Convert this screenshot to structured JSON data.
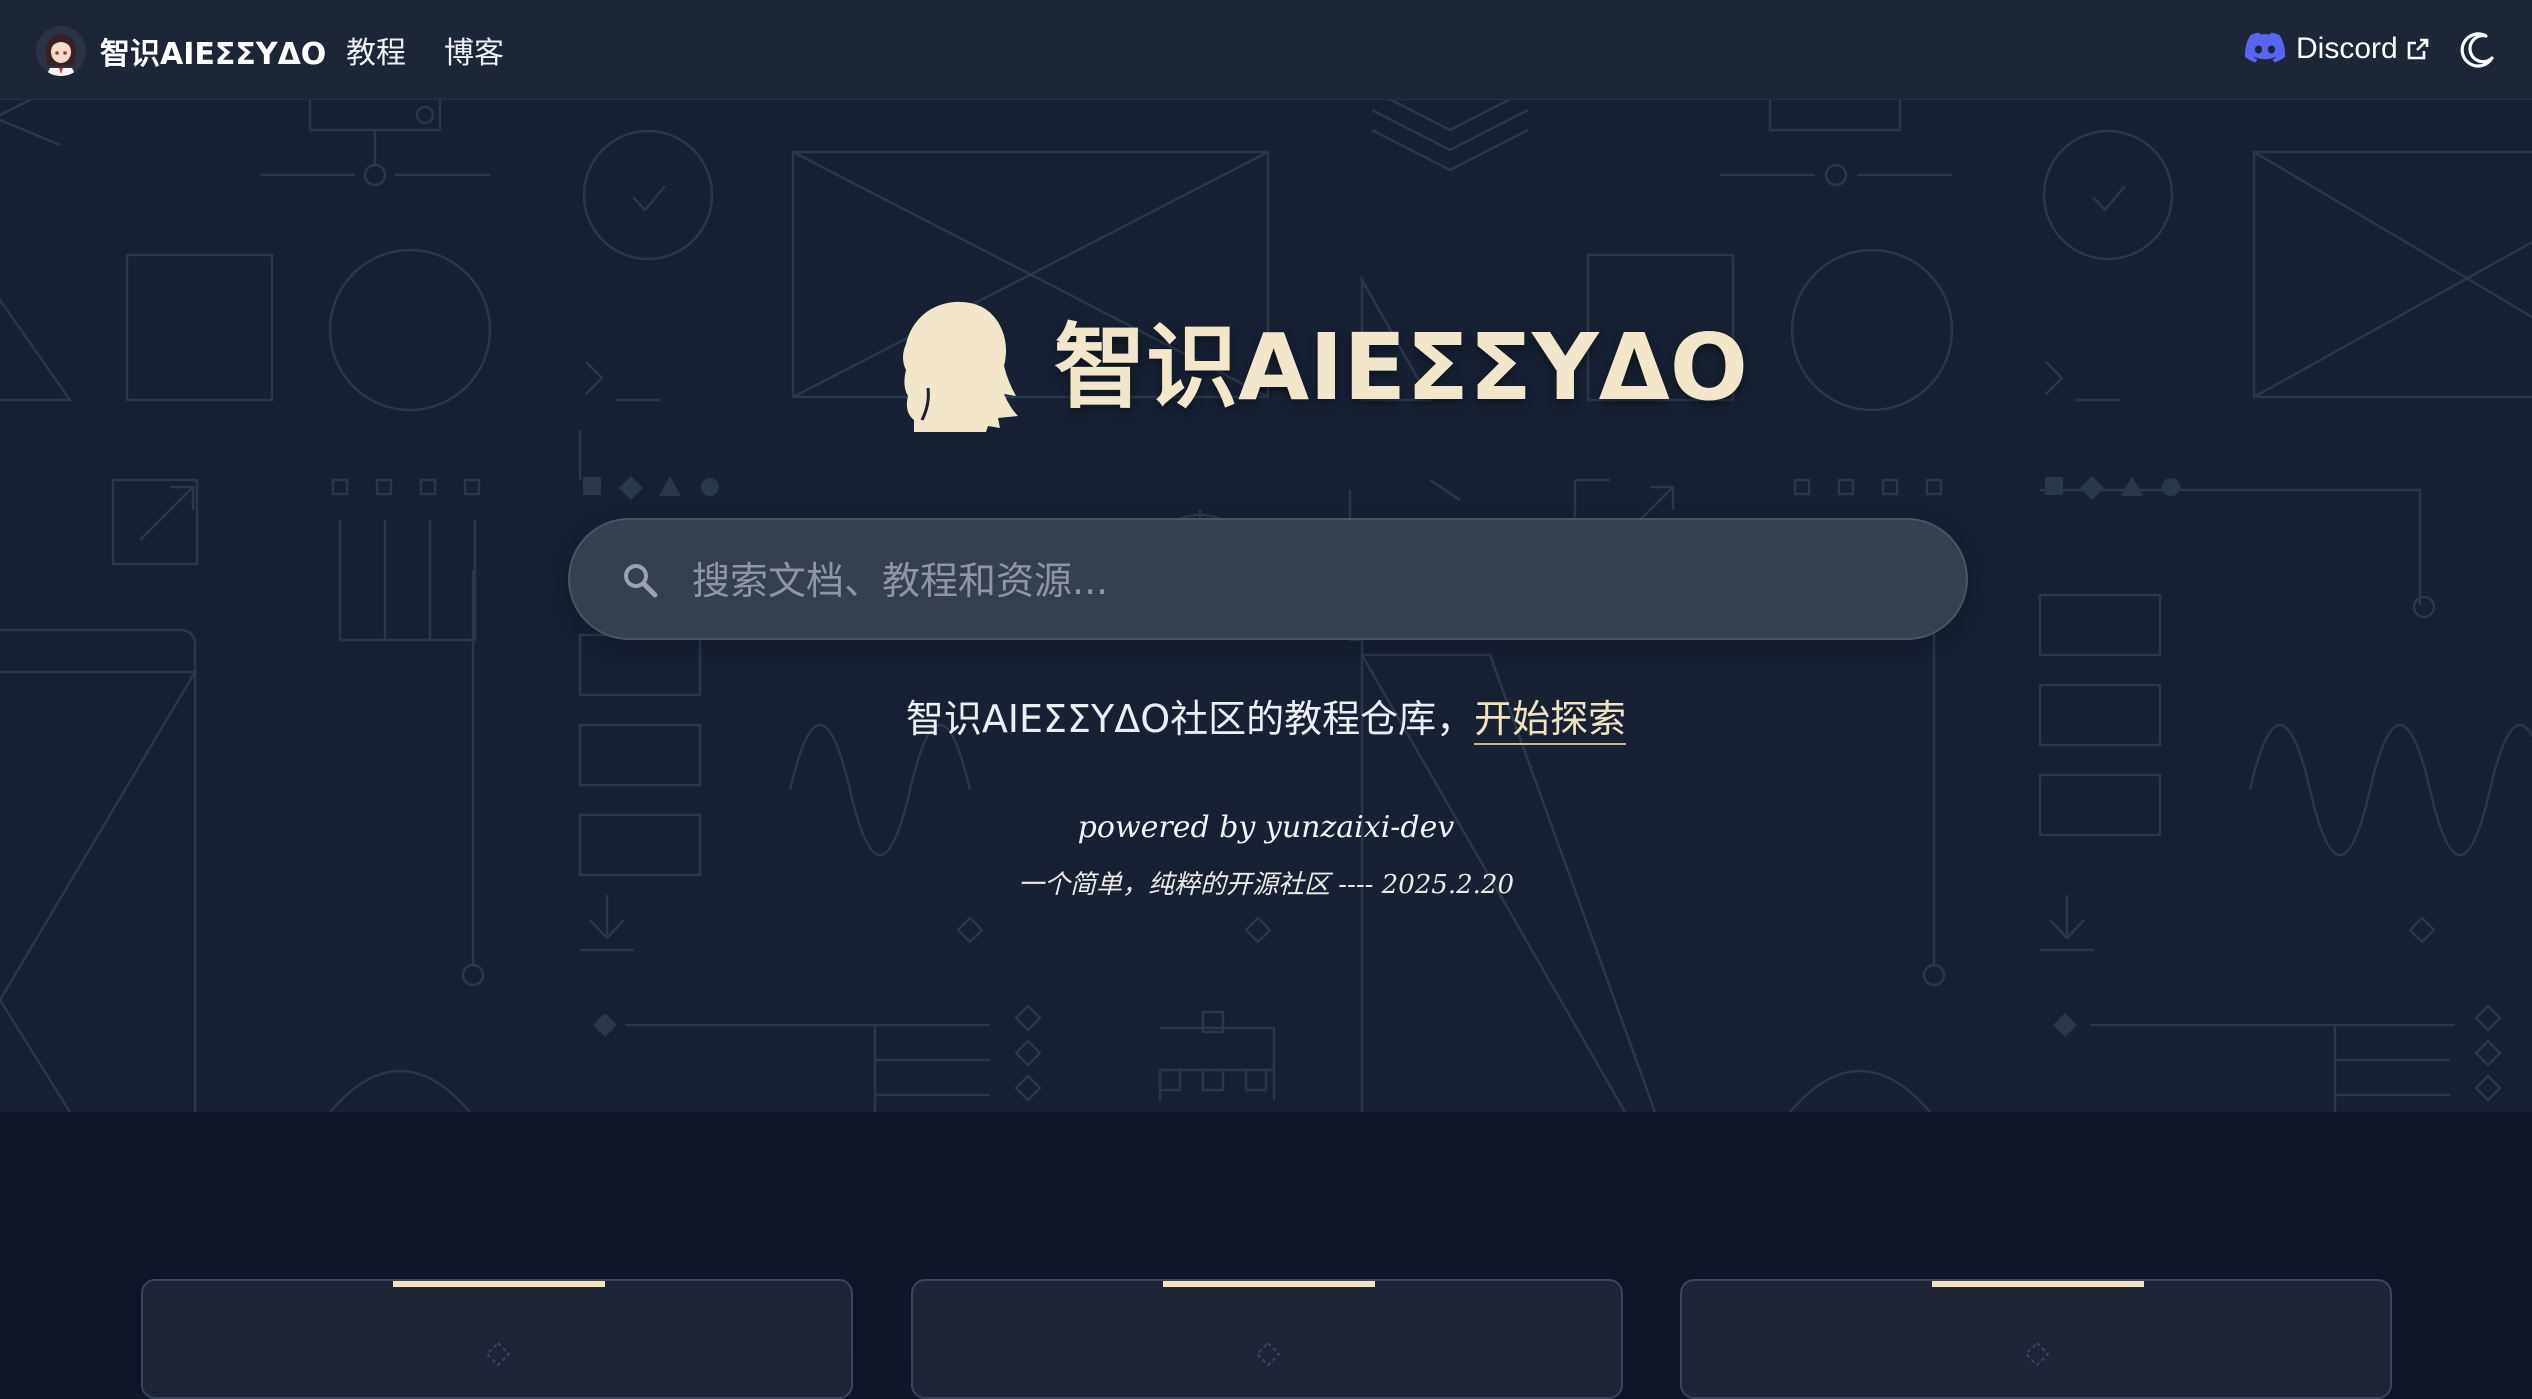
{
  "header": {
    "brand_title": "智识AIEΣΣYΔO",
    "nav": [
      "教程",
      "博客"
    ],
    "discord_label": "Discord",
    "theme_toggle_icon": "moon-icon"
  },
  "hero": {
    "title": "智识AIEΣΣYΔO",
    "search_placeholder": "搜索文档、教程和资源...",
    "tagline_text": "智识AIEΣΣYΔO社区的教程仓库，",
    "tagline_link": "开始探索",
    "powered_by": "powered by yunzaixi-dev",
    "motto": "一个简单，纯粹的开源社区 ---- 2025.2.20"
  },
  "cards": [
    {
      "icon": "diamond-icon"
    },
    {
      "icon": "diamond-icon"
    },
    {
      "icon": "diamond-icon"
    }
  ],
  "colors": {
    "header_bg": "#1c2636",
    "hero_bg": "#172133",
    "accent_cream": "#f2e3c0",
    "discord_blurple": "#5865F2",
    "cards_bg": "#0f1526"
  }
}
